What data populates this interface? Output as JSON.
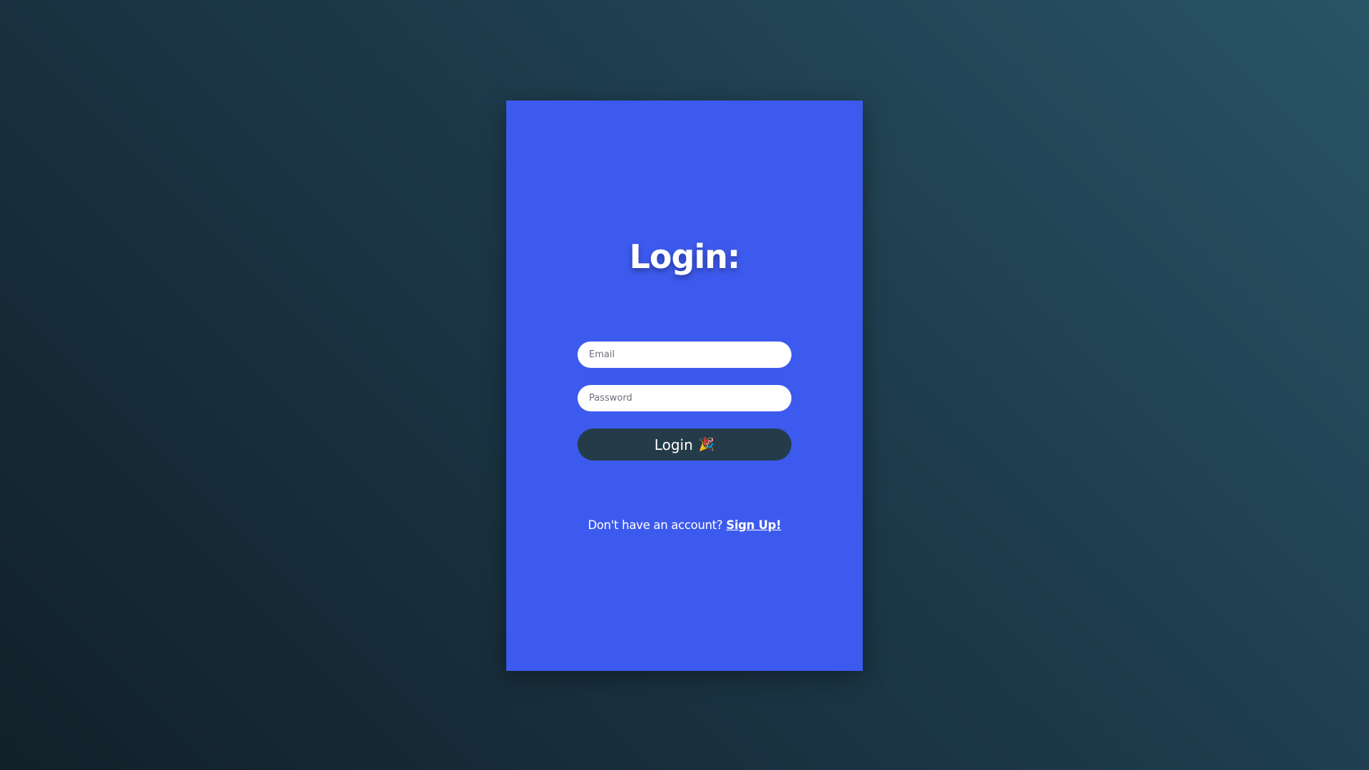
{
  "login_card": {
    "title": "Login:",
    "email_placeholder": "Email",
    "password_placeholder": "Password",
    "login_button_label": "Login",
    "login_button_icon": "party-popper-icon",
    "signup_prompt": "Don't have an account?",
    "signup_link": "Sign Up!"
  },
  "colors": {
    "card_background": "#3d5aee",
    "button_background": "#243c4a",
    "page_background_dark": "#112029",
    "page_background_light": "#285465",
    "text": "#ffffff"
  }
}
